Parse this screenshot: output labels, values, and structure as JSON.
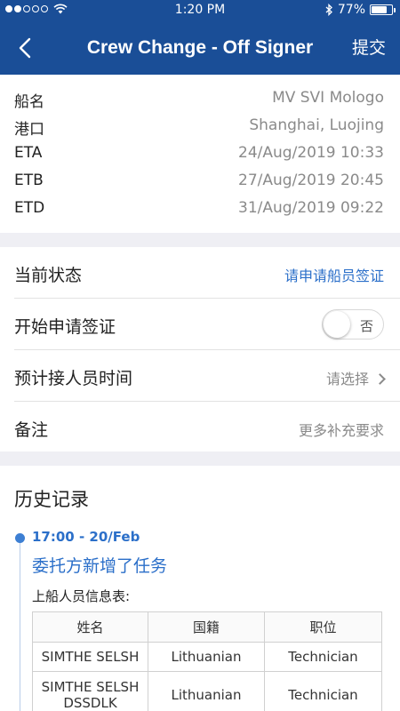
{
  "status_bar": {
    "time": "1:20 PM",
    "battery": "77%",
    "battery_level": 0.77
  },
  "navbar": {
    "title": "Crew Change - Off Signer",
    "submit_label": "提交",
    "back_icon": "chevron-left-icon"
  },
  "info": [
    {
      "label": "船名",
      "value": "MV SVI Mologo"
    },
    {
      "label": "港口",
      "value": "Shanghai, Luojing"
    },
    {
      "label": "ETA",
      "value": "24/Aug/2019 10:33"
    },
    {
      "label": "ETB",
      "value": "27/Aug/2019 20:45"
    },
    {
      "label": "ETD",
      "value": "31/Aug/2019 09:22"
    }
  ],
  "form": {
    "current_status_label": "当前状态",
    "current_status_value": "请申请船员签证",
    "visa_label": "开始申请签证",
    "visa_toggle_text": "否",
    "pickup_label": "预计接人员时间",
    "pickup_placeholder": "请选择",
    "remark_label": "备注",
    "remark_placeholder": "更多补充要求"
  },
  "history": {
    "title": "历史记录",
    "events": [
      {
        "time": "17:00 - 20/Feb",
        "title": "委托方新增了任务",
        "subtitle": "上船人员信息表:",
        "columns": [
          "姓名",
          "国籍",
          "职位"
        ],
        "rows": [
          [
            "SIMTHE SELSH",
            "Lithuanian",
            "Technician"
          ],
          [
            "SIMTHE SELSH DSSDLK",
            "Lithuanian",
            "Technician"
          ]
        ]
      }
    ]
  },
  "colors": {
    "primary": "#1a4e97",
    "link": "#2b6fc9",
    "muted": "#8a8a8a"
  }
}
